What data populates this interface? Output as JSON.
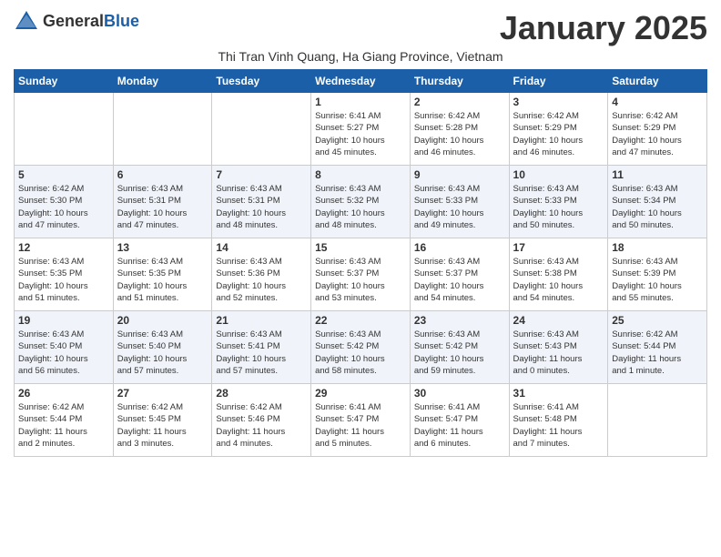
{
  "header": {
    "logo_general": "General",
    "logo_blue": "Blue",
    "title": "January 2025",
    "subtitle": "Thi Tran Vinh Quang, Ha Giang Province, Vietnam"
  },
  "columns": [
    "Sunday",
    "Monday",
    "Tuesday",
    "Wednesday",
    "Thursday",
    "Friday",
    "Saturday"
  ],
  "weeks": [
    [
      {
        "day": "",
        "info": ""
      },
      {
        "day": "",
        "info": ""
      },
      {
        "day": "",
        "info": ""
      },
      {
        "day": "1",
        "info": "Sunrise: 6:41 AM\nSunset: 5:27 PM\nDaylight: 10 hours\nand 45 minutes."
      },
      {
        "day": "2",
        "info": "Sunrise: 6:42 AM\nSunset: 5:28 PM\nDaylight: 10 hours\nand 46 minutes."
      },
      {
        "day": "3",
        "info": "Sunrise: 6:42 AM\nSunset: 5:29 PM\nDaylight: 10 hours\nand 46 minutes."
      },
      {
        "day": "4",
        "info": "Sunrise: 6:42 AM\nSunset: 5:29 PM\nDaylight: 10 hours\nand 47 minutes."
      }
    ],
    [
      {
        "day": "5",
        "info": "Sunrise: 6:42 AM\nSunset: 5:30 PM\nDaylight: 10 hours\nand 47 minutes."
      },
      {
        "day": "6",
        "info": "Sunrise: 6:43 AM\nSunset: 5:31 PM\nDaylight: 10 hours\nand 47 minutes."
      },
      {
        "day": "7",
        "info": "Sunrise: 6:43 AM\nSunset: 5:31 PM\nDaylight: 10 hours\nand 48 minutes."
      },
      {
        "day": "8",
        "info": "Sunrise: 6:43 AM\nSunset: 5:32 PM\nDaylight: 10 hours\nand 48 minutes."
      },
      {
        "day": "9",
        "info": "Sunrise: 6:43 AM\nSunset: 5:33 PM\nDaylight: 10 hours\nand 49 minutes."
      },
      {
        "day": "10",
        "info": "Sunrise: 6:43 AM\nSunset: 5:33 PM\nDaylight: 10 hours\nand 50 minutes."
      },
      {
        "day": "11",
        "info": "Sunrise: 6:43 AM\nSunset: 5:34 PM\nDaylight: 10 hours\nand 50 minutes."
      }
    ],
    [
      {
        "day": "12",
        "info": "Sunrise: 6:43 AM\nSunset: 5:35 PM\nDaylight: 10 hours\nand 51 minutes."
      },
      {
        "day": "13",
        "info": "Sunrise: 6:43 AM\nSunset: 5:35 PM\nDaylight: 10 hours\nand 51 minutes."
      },
      {
        "day": "14",
        "info": "Sunrise: 6:43 AM\nSunset: 5:36 PM\nDaylight: 10 hours\nand 52 minutes."
      },
      {
        "day": "15",
        "info": "Sunrise: 6:43 AM\nSunset: 5:37 PM\nDaylight: 10 hours\nand 53 minutes."
      },
      {
        "day": "16",
        "info": "Sunrise: 6:43 AM\nSunset: 5:37 PM\nDaylight: 10 hours\nand 54 minutes."
      },
      {
        "day": "17",
        "info": "Sunrise: 6:43 AM\nSunset: 5:38 PM\nDaylight: 10 hours\nand 54 minutes."
      },
      {
        "day": "18",
        "info": "Sunrise: 6:43 AM\nSunset: 5:39 PM\nDaylight: 10 hours\nand 55 minutes."
      }
    ],
    [
      {
        "day": "19",
        "info": "Sunrise: 6:43 AM\nSunset: 5:40 PM\nDaylight: 10 hours\nand 56 minutes."
      },
      {
        "day": "20",
        "info": "Sunrise: 6:43 AM\nSunset: 5:40 PM\nDaylight: 10 hours\nand 57 minutes."
      },
      {
        "day": "21",
        "info": "Sunrise: 6:43 AM\nSunset: 5:41 PM\nDaylight: 10 hours\nand 57 minutes."
      },
      {
        "day": "22",
        "info": "Sunrise: 6:43 AM\nSunset: 5:42 PM\nDaylight: 10 hours\nand 58 minutes."
      },
      {
        "day": "23",
        "info": "Sunrise: 6:43 AM\nSunset: 5:42 PM\nDaylight: 10 hours\nand 59 minutes."
      },
      {
        "day": "24",
        "info": "Sunrise: 6:43 AM\nSunset: 5:43 PM\nDaylight: 11 hours\nand 0 minutes."
      },
      {
        "day": "25",
        "info": "Sunrise: 6:42 AM\nSunset: 5:44 PM\nDaylight: 11 hours\nand 1 minute."
      }
    ],
    [
      {
        "day": "26",
        "info": "Sunrise: 6:42 AM\nSunset: 5:44 PM\nDaylight: 11 hours\nand 2 minutes."
      },
      {
        "day": "27",
        "info": "Sunrise: 6:42 AM\nSunset: 5:45 PM\nDaylight: 11 hours\nand 3 minutes."
      },
      {
        "day": "28",
        "info": "Sunrise: 6:42 AM\nSunset: 5:46 PM\nDaylight: 11 hours\nand 4 minutes."
      },
      {
        "day": "29",
        "info": "Sunrise: 6:41 AM\nSunset: 5:47 PM\nDaylight: 11 hours\nand 5 minutes."
      },
      {
        "day": "30",
        "info": "Sunrise: 6:41 AM\nSunset: 5:47 PM\nDaylight: 11 hours\nand 6 minutes."
      },
      {
        "day": "31",
        "info": "Sunrise: 6:41 AM\nSunset: 5:48 PM\nDaylight: 11 hours\nand 7 minutes."
      },
      {
        "day": "",
        "info": ""
      }
    ]
  ]
}
